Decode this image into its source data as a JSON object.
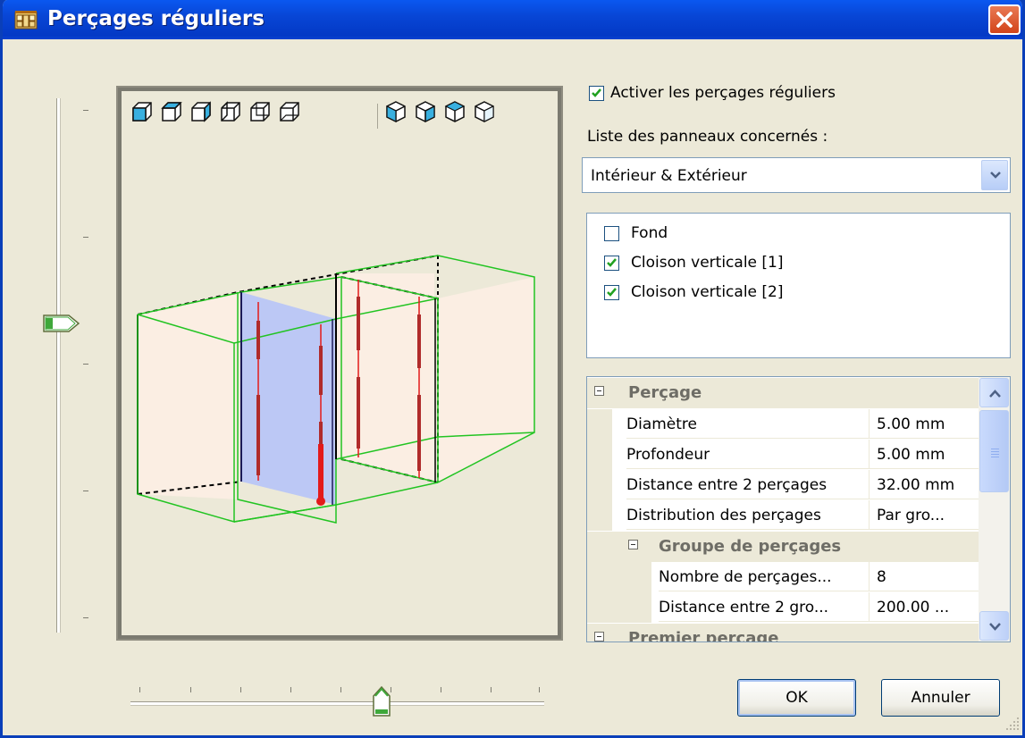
{
  "window": {
    "title": "Perçages réguliers"
  },
  "options": {
    "enable_label": "Activer les perçages réguliers",
    "enable_checked": true,
    "panels_list_label": "Liste des panneaux concernés :",
    "panels_combo_value": "Intérieur & Extérieur"
  },
  "panels": [
    {
      "label": "Fond",
      "checked": false
    },
    {
      "label": "Cloison verticale [1]",
      "checked": true
    },
    {
      "label": "Cloison verticale [2]",
      "checked": true
    }
  ],
  "properties": {
    "cat1": "Perçage",
    "rows": [
      {
        "name": "Diamètre",
        "value": "5.00 mm"
      },
      {
        "name": "Profondeur",
        "value": "5.00 mm"
      },
      {
        "name": "Distance entre 2 perçages",
        "value": "32.00 mm"
      },
      {
        "name": "Distribution des perçages",
        "value": "Par gro..."
      }
    ],
    "cat2": "Groupe de perçages",
    "subrows": [
      {
        "name": "Nombre de perçages...",
        "value": "8"
      },
      {
        "name": "Distance entre 2 gro...",
        "value": "200.00 ..."
      }
    ],
    "cat3": "Premier perçage"
  },
  "buttons": {
    "ok": "OK",
    "cancel": "Annuler"
  },
  "sliders": {
    "vertical_level": 0.42,
    "horizontal_level": 0.57
  },
  "view_toolbar": [
    "front-view-icon",
    "top-view-icon",
    "left-view-icon",
    "right-view-icon",
    "back-view-icon",
    "bottom-view-icon",
    "iso-view-1-icon",
    "iso-view-2-icon",
    "iso-view-3-icon",
    "iso-view-4-icon"
  ],
  "colors": {
    "title_bar": "#0846d6",
    "panel_fill": "#fbeee3",
    "selected_panel": "#bcc8f5",
    "wireframe": "#22c422",
    "drilling": "#e31a1a"
  }
}
